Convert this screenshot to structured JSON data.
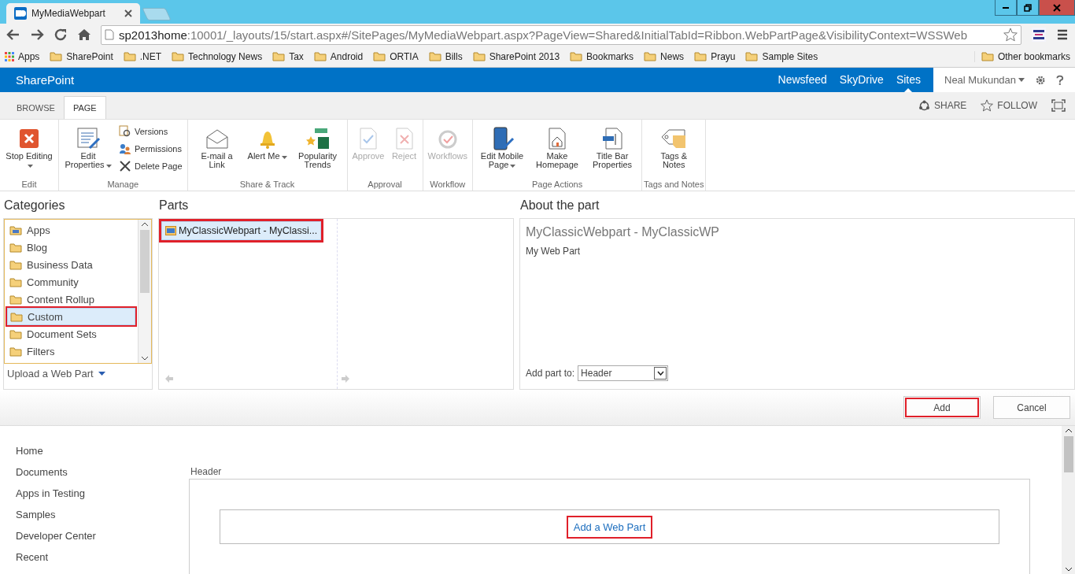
{
  "browser": {
    "tab_title": "MyMediaWebpart",
    "url_host": "sp2013home",
    "url_rest": ":10001/_layouts/15/start.aspx#/SitePages/MyMediaWebpart.aspx?PageView=Shared&InitialTabId=Ribbon.WebPartPage&VisibilityContext=WSSWeb",
    "apps_label": "Apps",
    "bookmarks": [
      "SharePoint",
      ".NET",
      "Technology News",
      "Tax",
      "Android",
      "ORTIA",
      "Bills",
      "SharePoint 2013",
      "Bookmarks",
      "News",
      "Prayu",
      "Sample Sites"
    ],
    "other_bookmarks": "Other bookmarks"
  },
  "suite_bar": {
    "brand": "SharePoint",
    "links": [
      {
        "label": "Newsfeed",
        "selected": false
      },
      {
        "label": "SkyDrive",
        "selected": false
      },
      {
        "label": "Sites",
        "selected": true
      }
    ],
    "user": "Neal Mukundan"
  },
  "ribbon": {
    "tabs": [
      {
        "label": "BROWSE",
        "selected": false
      },
      {
        "label": "PAGE",
        "selected": true
      }
    ],
    "actions": [
      "SHARE",
      "FOLLOW"
    ],
    "groups": [
      {
        "label": "Edit",
        "items": [
          {
            "kind": "large",
            "label": "Stop Editing",
            "dropdown": true,
            "disabled": false
          }
        ]
      },
      {
        "label": "Manage",
        "items": [
          {
            "kind": "large",
            "label": "Edit Properties",
            "dropdown": true,
            "disabled": false
          },
          {
            "kind": "small",
            "label": "Versions",
            "dropdown": false,
            "disabled": false
          },
          {
            "kind": "small",
            "label": "Permissions",
            "dropdown": false,
            "disabled": false
          },
          {
            "kind": "small",
            "label": "Delete Page",
            "dropdown": false,
            "disabled": false
          }
        ]
      },
      {
        "label": "Share & Track",
        "items": [
          {
            "kind": "large",
            "label": "E-mail a Link",
            "dropdown": false,
            "disabled": false
          },
          {
            "kind": "large",
            "label": "Alert Me",
            "dropdown": true,
            "disabled": false
          },
          {
            "kind": "large",
            "label": "Popularity Trends",
            "dropdown": false,
            "disabled": false
          }
        ]
      },
      {
        "label": "Approval",
        "items": [
          {
            "kind": "large",
            "label": "Approve",
            "dropdown": false,
            "disabled": true
          },
          {
            "kind": "large",
            "label": "Reject",
            "dropdown": false,
            "disabled": true
          }
        ]
      },
      {
        "label": "Workflow",
        "items": [
          {
            "kind": "large",
            "label": "Workflows",
            "dropdown": false,
            "disabled": true
          }
        ]
      },
      {
        "label": "Page Actions",
        "items": [
          {
            "kind": "large",
            "label": "Edit Mobile Page",
            "dropdown": true,
            "disabled": false
          },
          {
            "kind": "large",
            "label": "Make Homepage",
            "dropdown": false,
            "disabled": false
          },
          {
            "kind": "large",
            "label": "Title Bar Properties",
            "dropdown": false,
            "disabled": false
          }
        ]
      },
      {
        "label": "Tags and Notes",
        "items": [
          {
            "kind": "large",
            "label": "Tags & Notes",
            "dropdown": false,
            "disabled": false
          }
        ]
      }
    ]
  },
  "adder": {
    "categories_title": "Categories",
    "categories": [
      {
        "label": "Apps",
        "selected": false,
        "highlighted": false
      },
      {
        "label": "Blog",
        "selected": false,
        "highlighted": false
      },
      {
        "label": "Business Data",
        "selected": false,
        "highlighted": false
      },
      {
        "label": "Community",
        "selected": false,
        "highlighted": false
      },
      {
        "label": "Content Rollup",
        "selected": false,
        "highlighted": false
      },
      {
        "label": "Custom",
        "selected": true,
        "highlighted": true
      },
      {
        "label": "Document Sets",
        "selected": false,
        "highlighted": false
      },
      {
        "label": "Filters",
        "selected": false,
        "highlighted": false
      }
    ],
    "upload_link": "Upload a Web Part",
    "parts_title": "Parts",
    "parts": [
      {
        "label": "MyClassicWebpart - MyClassi...",
        "selected": true,
        "highlighted": true
      }
    ],
    "about_title": "About the part",
    "part_name": "MyClassicWebpart - MyClassicWP",
    "part_description": "My Web Part",
    "add_to_label": "Add part to:",
    "add_to_value": "Header",
    "buttons": [
      {
        "label": "Add",
        "highlighted": true
      },
      {
        "label": "Cancel",
        "highlighted": false
      }
    ]
  },
  "page": {
    "nav": [
      "Home",
      "Documents",
      "Apps in Testing",
      "Samples",
      "Developer Center",
      "Recent"
    ],
    "zone_title": "Header",
    "add_link": {
      "label": "Add a Web Part",
      "highlighted": true
    }
  }
}
